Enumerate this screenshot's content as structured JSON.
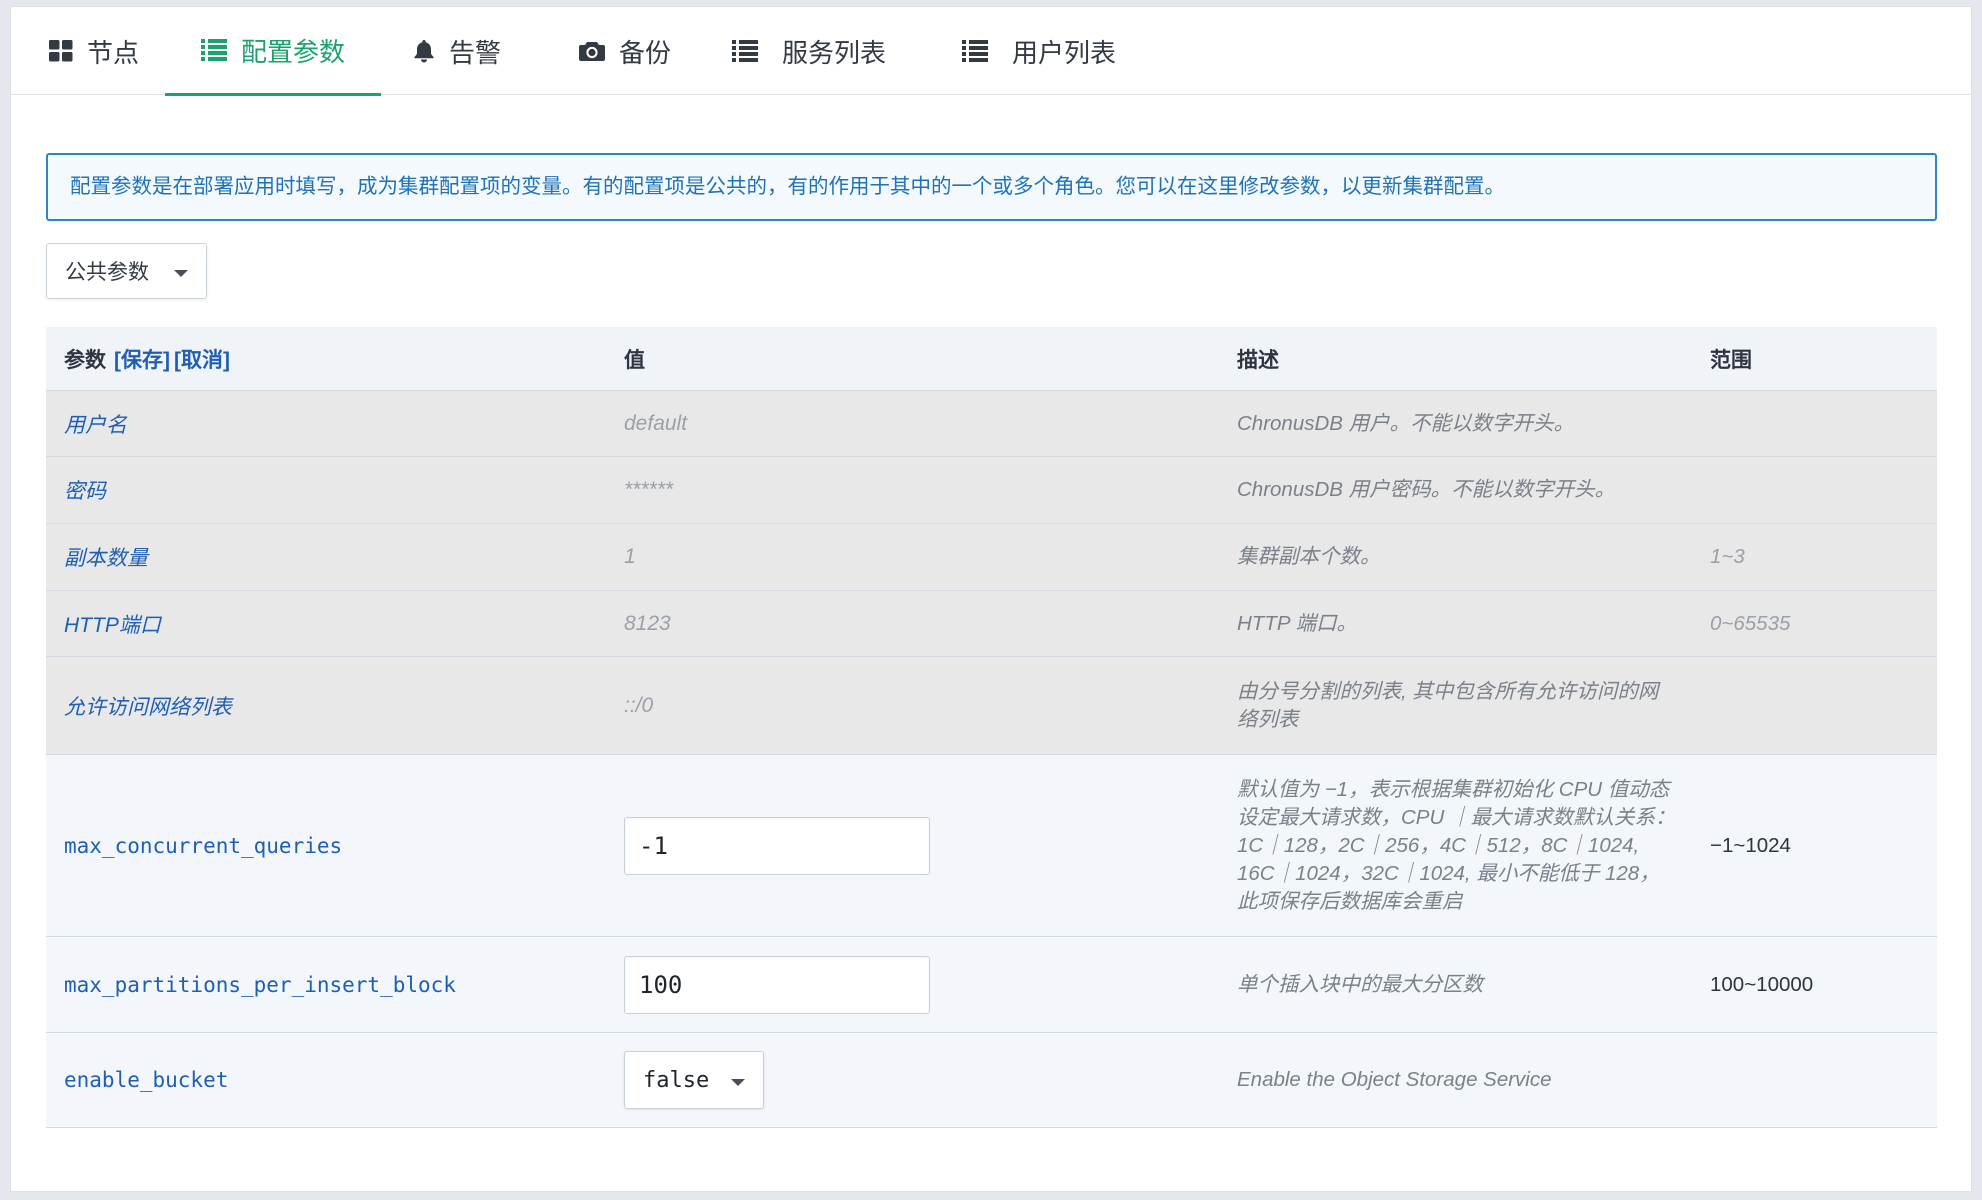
{
  "tabs": [
    {
      "label": "节点",
      "icon": "grid-icon"
    },
    {
      "label": "配置参数",
      "icon": "list-icon",
      "active": true
    },
    {
      "label": "告警",
      "icon": "bell-icon"
    },
    {
      "label": "备份",
      "icon": "camera-icon"
    },
    {
      "label": "服务列表",
      "icon": "list-icon"
    },
    {
      "label": "用户列表",
      "icon": "list-icon"
    }
  ],
  "accent_color": "#1aa36b",
  "link_color": "#1e5fb4",
  "alert": {
    "text": "配置参数是在部署应用时填写，成为集群配置项的变量。有的配置项是公共的，有的作用于其中的一个或多个角色。您可以在这里修改参数，以更新集群配置。"
  },
  "param_scope": {
    "selected": "公共参数"
  },
  "table": {
    "headers": {
      "param": "参数",
      "save": "[保存]",
      "cancel": "[取消]",
      "value": "值",
      "description": "描述",
      "range": "范围"
    },
    "rows": [
      {
        "name": "用户名",
        "value": "default",
        "description": "ChronusDB 用户。不能以数字开头。",
        "range": ""
      },
      {
        "name": "密码",
        "value": "******",
        "description": "ChronusDB 用户密码。不能以数字开头。",
        "range": ""
      },
      {
        "name": "副本数量",
        "value": "1",
        "description": "集群副本个数。",
        "range": "1~3"
      },
      {
        "name": "HTTP端口",
        "value": "8123",
        "description": "HTTP 端口。",
        "range": "0~65535"
      },
      {
        "name": "允许访问网络列表",
        "value": "::/0",
        "description": "由分号分割的列表, 其中包含所有允许访问的网络列表",
        "range": ""
      },
      {
        "name": "max_concurrent_queries",
        "value": "-1",
        "description": "默认值为 −1，表示根据集群初始化 CPU 值动态设定最大请求数，CPU ｜最大请求数默认关系： 1C｜128，2C｜256，4C｜512，8C｜1024, 16C｜1024，32C｜1024, 最小不能低于 128，此项保存后数据库会重启",
        "range": "−1~1024"
      },
      {
        "name": "max_partitions_per_insert_block",
        "value": "100",
        "description": "单个插入块中的最大分区数",
        "range": "100~10000"
      },
      {
        "name": "enable_bucket",
        "value": "false",
        "description": "Enable the Object Storage Service",
        "range": ""
      }
    ]
  }
}
